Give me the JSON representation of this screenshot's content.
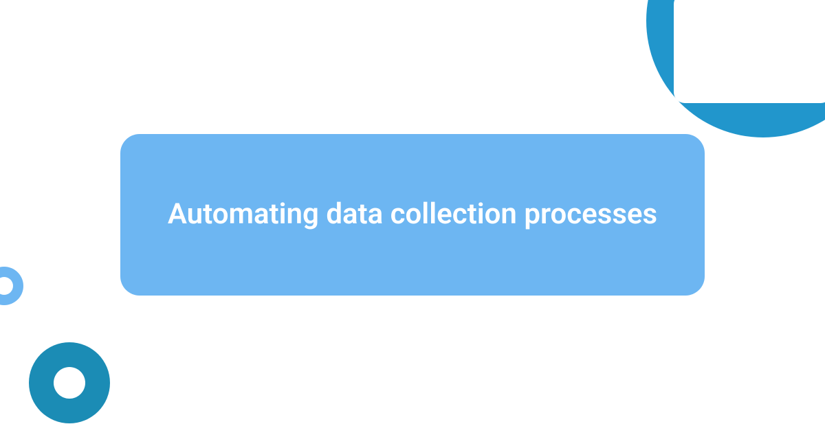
{
  "main": {
    "title": "Automating data collection processes"
  },
  "colors": {
    "cardBackground": "#6db6f2",
    "accentDark": "#1b8cb5",
    "accentTeal": "#2196cc",
    "textLight": "#ffffff"
  }
}
